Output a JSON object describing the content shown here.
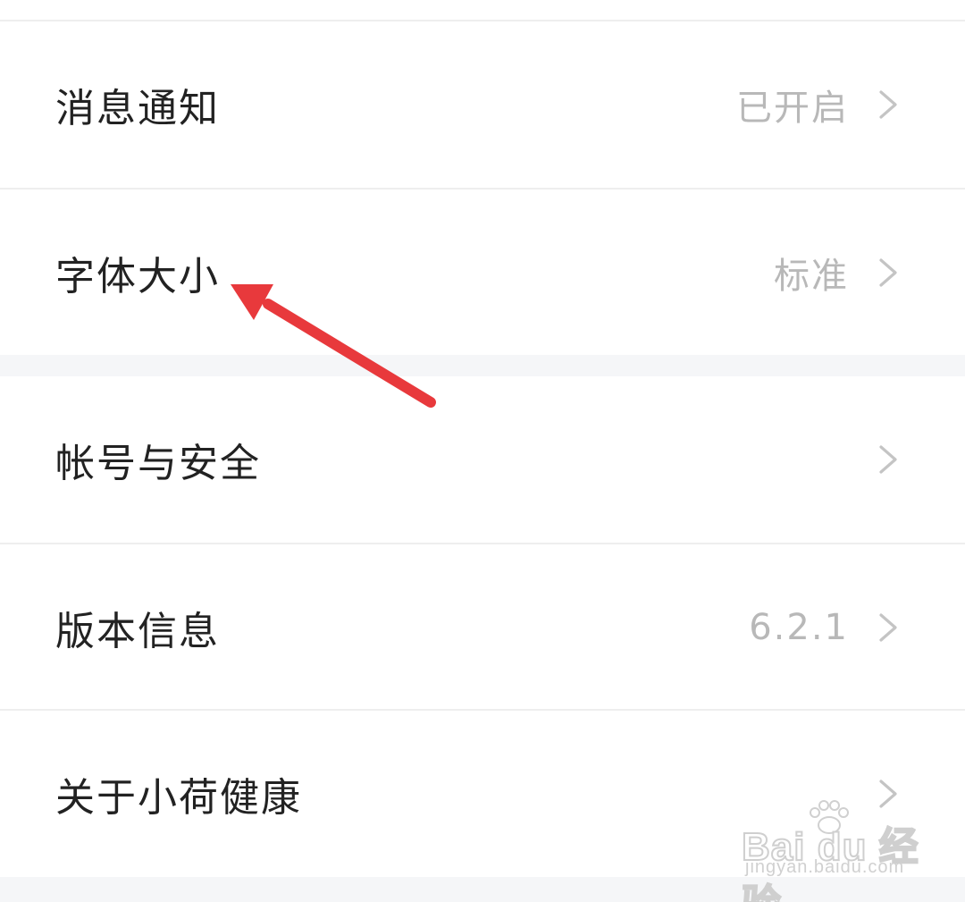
{
  "settings": {
    "group1": [
      {
        "label": "消息通知",
        "value": "已开启"
      },
      {
        "label": "字体大小",
        "value": "标准"
      }
    ],
    "group2": [
      {
        "label": "帐号与安全",
        "value": ""
      },
      {
        "label": "版本信息",
        "value": "6.2.1"
      },
      {
        "label": "关于小荷健康",
        "value": ""
      }
    ]
  },
  "icons": {
    "row_chevron": "chevron-right-icon",
    "annotation": "red-arrow-icon"
  },
  "colors": {
    "background": "#f5f6f8",
    "card": "#ffffff",
    "label_text": "#222222",
    "value_text": "#b8b8b8",
    "chevron": "#c4c4c4",
    "annotation_arrow": "#e8393c"
  },
  "watermark": {
    "main": "Bai du 经验",
    "sub": "jingyan.baidu.com"
  }
}
